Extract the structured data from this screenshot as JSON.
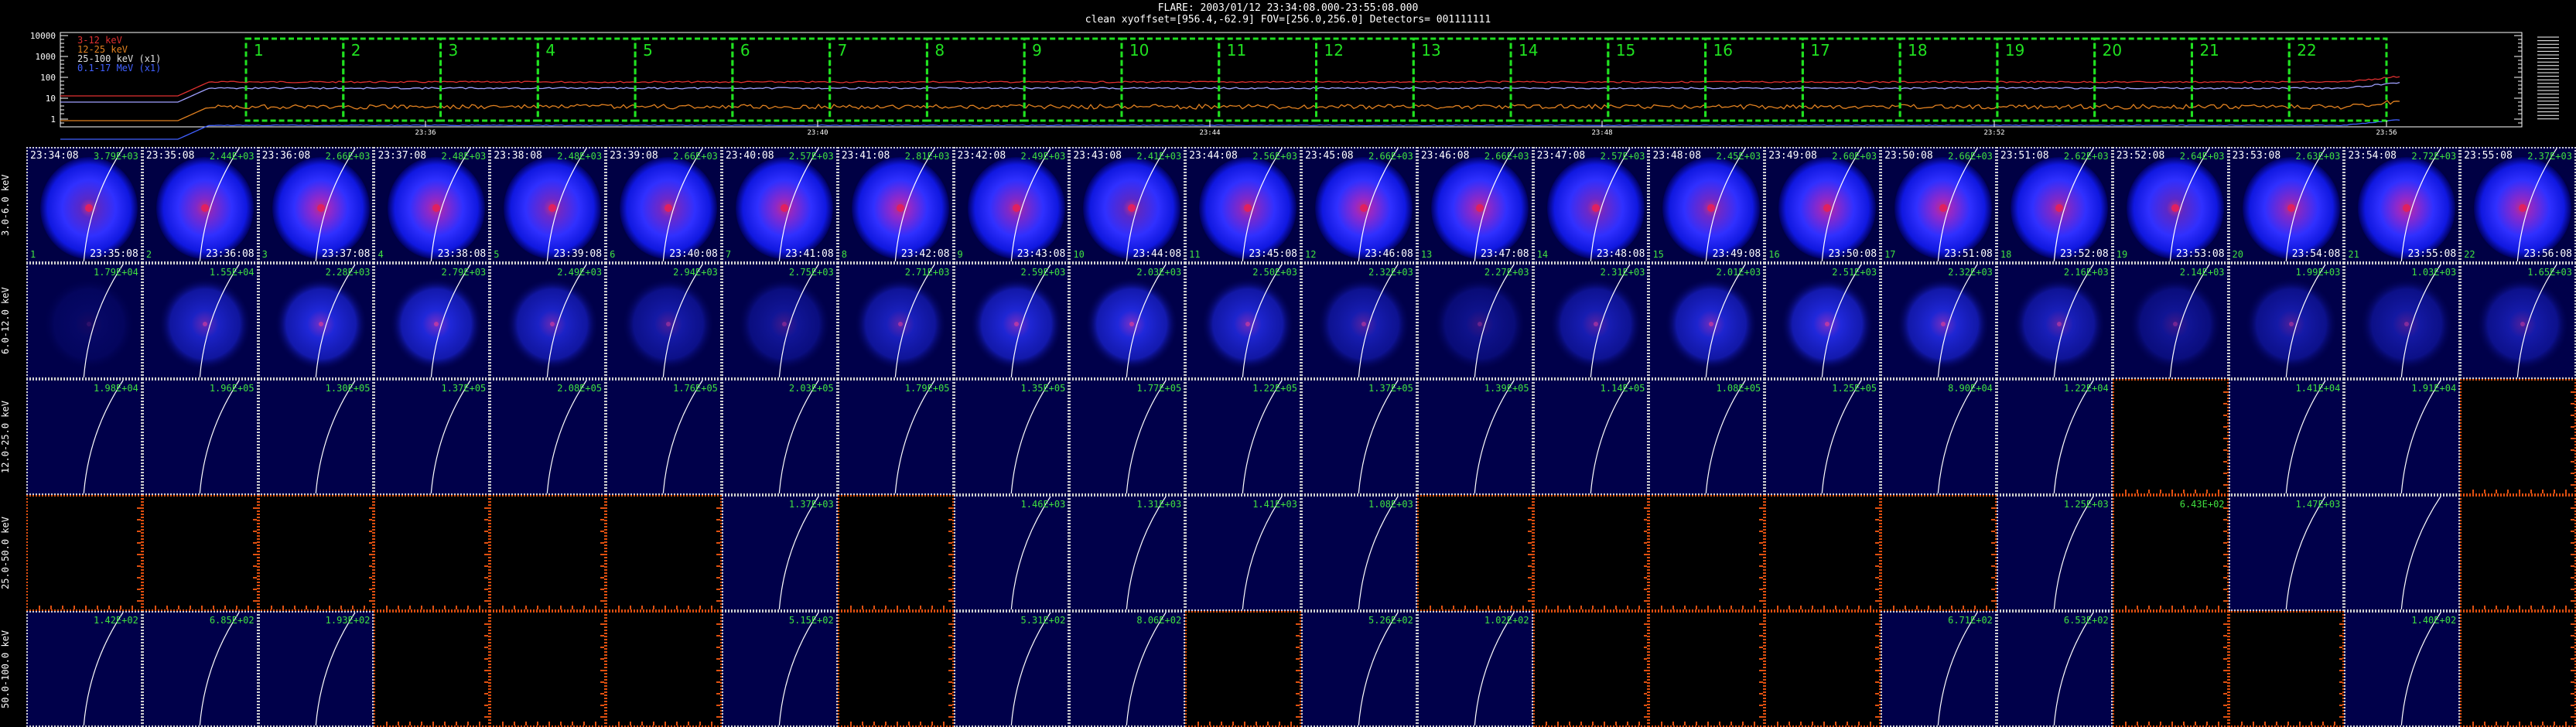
{
  "header": {
    "line1": "FLARE: 2003/01/12 23:34:08.000-23:55:08.000",
    "line2": "clean    xyoffset=[956.4,-62.9]   FOV=[256.0,256.0]    Detectors= 001111111"
  },
  "lightcurve": {
    "yticks": [
      "10000",
      "1000",
      "100",
      "10",
      "1"
    ],
    "legend": [
      {
        "label": "3-12 keV",
        "color": "#e03030"
      },
      {
        "label": "12-25 keV",
        "color": "#e08020"
      },
      {
        "label": "25-100 keV (x1)",
        "color": "#e0e0e0"
      },
      {
        "label": "0.1-17 MeV (x1)",
        "color": "#4060ff"
      }
    ],
    "time_labels": [
      "23:36",
      "23:40",
      "23:44",
      "23:48",
      "23:52",
      "23:56"
    ],
    "interval_numbers": [
      "1",
      "2",
      "3",
      "4",
      "5",
      "6",
      "7",
      "8",
      "9",
      "10",
      "11",
      "12",
      "13",
      "14",
      "15",
      "16",
      "17",
      "18",
      "19",
      "20",
      "21",
      "22"
    ],
    "box_color": "#20e020"
  },
  "energy_bands": [
    "3.0-6.0 keV",
    "6.0-12.0 keV",
    "12.0-25.0 keV",
    "25.0-50.0 keV",
    "50.0-100.0 keV"
  ],
  "start_times": [
    "23:34:08",
    "23:35:08",
    "23:36:08",
    "23:37:08",
    "23:38:08",
    "23:39:08",
    "23:40:08",
    "23:41:08",
    "23:42:08",
    "23:43:08",
    "23:44:08",
    "23:45:08",
    "23:46:08",
    "23:47:08",
    "23:48:08",
    "23:49:08",
    "23:50:08",
    "23:51:08",
    "23:52:08",
    "23:53:08",
    "23:54:08",
    "23:55:08"
  ],
  "end_times": [
    "23:35:08",
    "23:36:08",
    "23:37:08",
    "23:38:08",
    "23:39:08",
    "23:40:08",
    "23:41:08",
    "23:42:08",
    "23:43:08",
    "23:44:08",
    "23:45:08",
    "23:46:08",
    "23:47:08",
    "23:48:08",
    "23:49:08",
    "23:50:08",
    "23:51:08",
    "23:52:08",
    "23:53:08",
    "23:54:08",
    "23:55:08",
    "23:56:08"
  ],
  "maxima": [
    [
      "3.79E+03",
      "2.44E+03",
      "2.66E+03",
      "2.48E+03",
      "2.48E+03",
      "2.66E+03",
      "2.57E+03",
      "2.81E+03",
      "2.49E+03",
      "2.41E+03",
      "2.56E+03",
      "2.66E+03",
      "2.66E+03",
      "2.57E+03",
      "2.45E+03",
      "2.60E+03",
      "2.66E+03",
      "2.62E+03",
      "2.64E+03",
      "2.63E+03",
      "2.72E+03",
      "2.37E+03"
    ],
    [
      "1.79E+04",
      "1.55E+04",
      "2.28E+03",
      "2.79E+03",
      "2.49E+03",
      "2.94E+03",
      "2.75E+03",
      "2.71E+03",
      "2.59E+03",
      "2.03E+03",
      "2.50E+03",
      "2.32E+03",
      "2.27E+03",
      "2.31E+03",
      "2.01E+03",
      "2.51E+03",
      "2.32E+03",
      "2.16E+03",
      "2.14E+03",
      "1.99E+03",
      "1.03E+03",
      "1.65E+03"
    ],
    [
      "1.98E+04",
      "1.96E+05",
      "1.30E+05",
      "1.37E+05",
      "2.08E+05",
      "1.76E+05",
      "2.03E+05",
      "1.79E+05",
      "1.35E+05",
      "1.77E+05",
      "1.22E+05",
      "1.37E+05",
      "1.39E+05",
      "1.14E+05",
      "1.08E+05",
      "1.25E+05",
      "8.90E+04",
      "1.22E+04",
      "",
      "1.41E+04",
      "1.91E+04",
      ""
    ],
    [
      "",
      "",
      "",
      "",
      "",
      "",
      "1.37E+03",
      "",
      "1.46E+03",
      "1.31E+03",
      "1.41E+03",
      "1.08E+03",
      "",
      "",
      "",
      "",
      "",
      "1.25E+03",
      "6.43E+02",
      "1.47E+03",
      "",
      ""
    ],
    [
      "1.42E+02",
      "6.85E+02",
      "1.93E+02",
      "",
      "",
      "",
      "5.15E+02",
      "",
      "5.31E+02",
      "8.06E+02",
      "",
      "5.26E+02",
      "1.02E+02",
      "",
      "",
      "",
      "6.71E+02",
      "6.53E+02",
      "",
      "",
      "1.40E+02",
      ""
    ]
  ],
  "row_types": [
    [
      "s",
      "s",
      "s",
      "s",
      "s",
      "s",
      "s",
      "s",
      "s",
      "s",
      "s",
      "s",
      "s",
      "s",
      "s",
      "s",
      "s",
      "s",
      "s",
      "s",
      "s",
      "s"
    ],
    [
      "d",
      "f",
      "f",
      "f",
      "f",
      "f",
      "f",
      "f",
      "f",
      "f",
      "f",
      "f",
      "f",
      "f",
      "f",
      "f",
      "f",
      "f",
      "f",
      "f",
      "f",
      "f"
    ],
    [
      "e",
      "e",
      "e",
      "e",
      "e",
      "e",
      "e",
      "e",
      "e",
      "e",
      "e",
      "e",
      "e",
      "e",
      "e",
      "e",
      "e",
      "e",
      "x",
      "e",
      "e",
      "x"
    ],
    [
      "x",
      "x",
      "x",
      "x",
      "x",
      "x",
      "e",
      "x",
      "e",
      "e",
      "e",
      "e",
      "x",
      "x",
      "x",
      "x",
      "x",
      "e",
      "x",
      "e",
      "e",
      "x"
    ],
    [
      "e",
      "e",
      "e",
      "x",
      "x",
      "x",
      "e",
      "x",
      "e",
      "e",
      "x",
      "e",
      "e",
      "x",
      "x",
      "x",
      "e",
      "e",
      "x",
      "x",
      "e",
      "x"
    ]
  ],
  "colors": {
    "grid_border": "#d0d0d0",
    "empty_border": "#e05010",
    "limb": "#ffffff",
    "cell_bg": "#00004a"
  }
}
